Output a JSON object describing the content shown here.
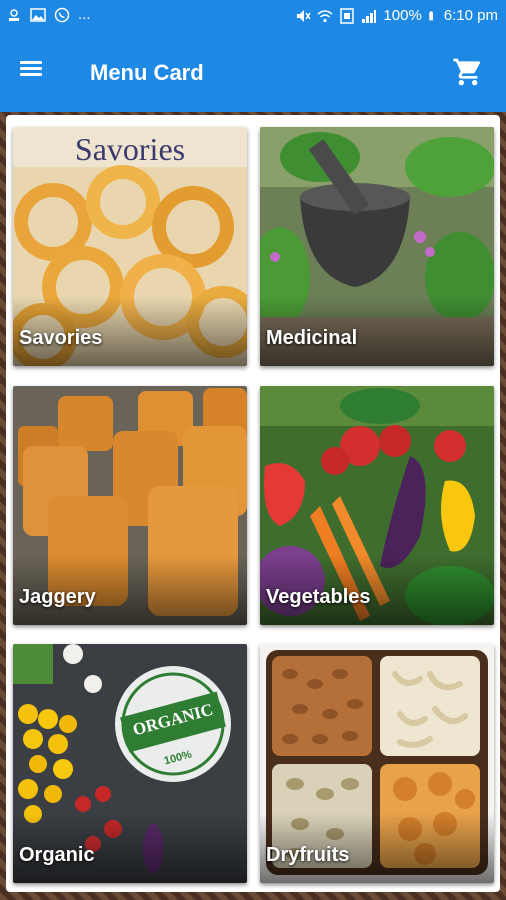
{
  "status_bar": {
    "left_text": "...",
    "battery": "100%",
    "time": "6:10 pm"
  },
  "app_bar": {
    "menu_icon": "hamburger-menu-icon",
    "title": "Menu Card",
    "cart_icon": "shopping-cart-icon",
    "color": "#1e88e5"
  },
  "categories": [
    {
      "label": "Savories",
      "banner": "Savories"
    },
    {
      "label": "Medicinal"
    },
    {
      "label": "Jaggery"
    },
    {
      "label": "Vegetables"
    },
    {
      "label": "Organic",
      "stamp_text": "ORGANIC",
      "stamp_sub": "100%"
    },
    {
      "label": "Dryfruits"
    }
  ]
}
